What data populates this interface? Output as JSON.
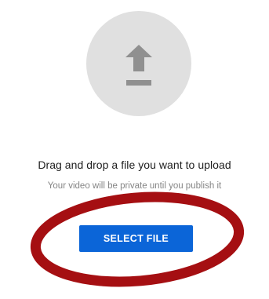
{
  "upload": {
    "icon": "upload-arrow-icon",
    "headline": "Drag and drop a file you want to upload",
    "subline": "Your video will be private until you publish it",
    "button_label": "SELECT FILE"
  },
  "colors": {
    "circle_bg": "#e0e0e0",
    "icon": "#909090",
    "button_bg": "#0b65d8",
    "annotation": "#a50f12"
  }
}
